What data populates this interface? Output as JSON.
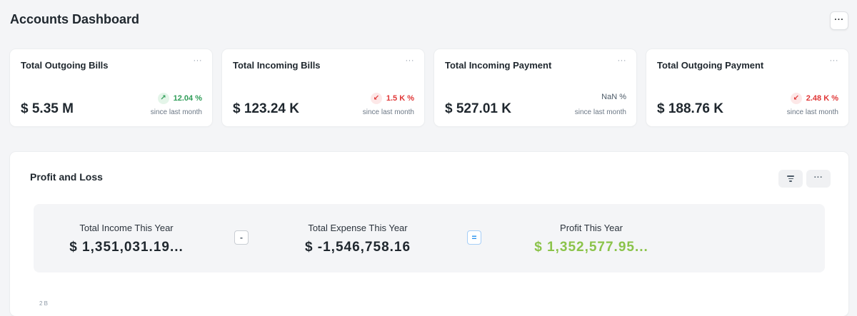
{
  "header": {
    "title": "Accounts Dashboard",
    "menu_label": "···"
  },
  "cards": [
    {
      "title": "Total Outgoing Bills",
      "value": "$ 5.35 M",
      "delta": "12.04 %",
      "trend": "up",
      "trend_icon": "↗",
      "since": "since last month",
      "menu": "···"
    },
    {
      "title": "Total Incoming Bills",
      "value": "$ 123.24 K",
      "delta": "1.5 K %",
      "trend": "down",
      "trend_icon": "↙",
      "since": "since last month",
      "menu": "···"
    },
    {
      "title": "Total Incoming Payment",
      "value": "$ 527.01 K",
      "delta": "NaN %",
      "trend": "neutral",
      "trend_icon": "",
      "since": "since last month",
      "menu": "···"
    },
    {
      "title": "Total Outgoing Payment",
      "value": "$ 188.76 K",
      "delta": "2.48 K %",
      "trend": "down",
      "trend_icon": "↙",
      "since": "since last month",
      "menu": "···"
    }
  ],
  "profit_loss": {
    "title": "Profit and Loss",
    "more_label": "···",
    "income_label": "Total Income This Year",
    "income_value": "$ 1,351,031.19...",
    "minus_symbol": "-",
    "expense_label": "Total Expense This Year",
    "expense_value": "$ -1,546,758.16",
    "equals_symbol": "=",
    "profit_label": "Profit This Year",
    "profit_value": "$ 1,352,577.95...",
    "chart_tick": "2 B"
  },
  "colors": {
    "positive": "#2f9d58",
    "negative": "#e03636",
    "profit": "#8bc34a",
    "accent": "#2490ef"
  },
  "icons": {
    "header_menu": "more-horizontal-icon",
    "card_menu": "more-horizontal-icon",
    "trend_up": "arrow-up-right-icon",
    "trend_down": "arrow-down-left-icon",
    "filter": "filter-icon"
  }
}
